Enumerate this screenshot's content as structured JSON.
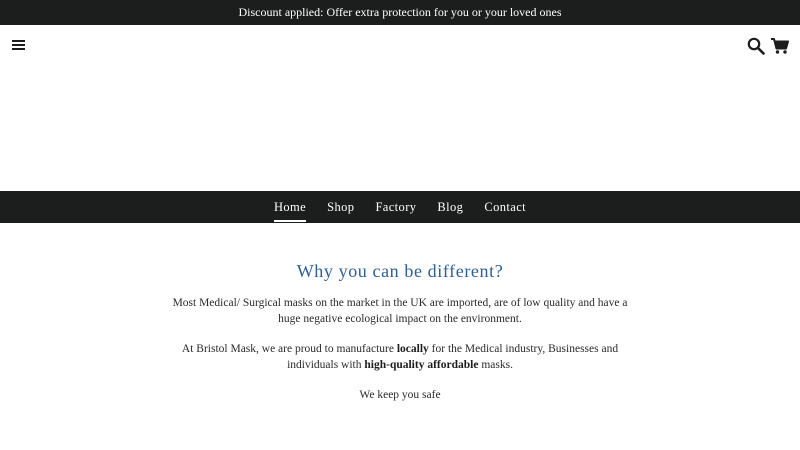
{
  "announcement": "Discount applied: Offer extra protection for you or your loved ones",
  "header": {
    "menu_icon": "hamburger-menu-icon",
    "search_icon": "search-icon",
    "cart_icon": "cart-icon"
  },
  "nav": {
    "items": [
      {
        "label": "Home",
        "active": true
      },
      {
        "label": "Shop",
        "active": false
      },
      {
        "label": "Factory",
        "active": false
      },
      {
        "label": "Blog",
        "active": false
      },
      {
        "label": "Contact",
        "active": false
      }
    ]
  },
  "main": {
    "heading": "Why you can be different?",
    "paragraph1": "Most Medical/ Surgical masks on the market in the UK are imported, are of low quality and have a huge negative ecological impact on the environment.",
    "paragraph2": {
      "part1": "At Bristol Mask, we are proud to manufacture ",
      "bold1": "locally",
      "part2": " for the Medical industry, Businesses and individuals with ",
      "bold2": "high-quality affordable",
      "part3": " masks."
    },
    "paragraph3": "We keep you safe"
  },
  "colors": {
    "dark": "#1c1d1d",
    "heading_blue": "#2b5f98",
    "background": "#ffffff"
  }
}
